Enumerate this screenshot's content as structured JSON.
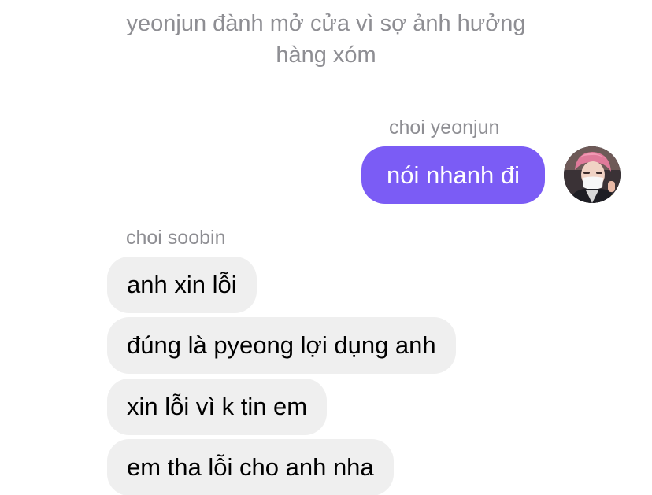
{
  "narration": {
    "line1": "yeonjun đành mở cửa vì sợ ảnh hưởng",
    "line2": "hàng xóm"
  },
  "outgoing": {
    "sender": "choi yeonjun",
    "message": "nói nhanh đi",
    "bubble_color": "#7b5cf5",
    "avatar_icon": "profile-photo-pink-hair-mask"
  },
  "incoming": {
    "sender": "choi soobin",
    "bubble_color": "#efefef",
    "messages": [
      "anh xin lỗi",
      "đúng là pyeong lợi dụng anh",
      "xin lỗi vì k tin em",
      "em tha lỗi cho anh nha"
    ]
  }
}
